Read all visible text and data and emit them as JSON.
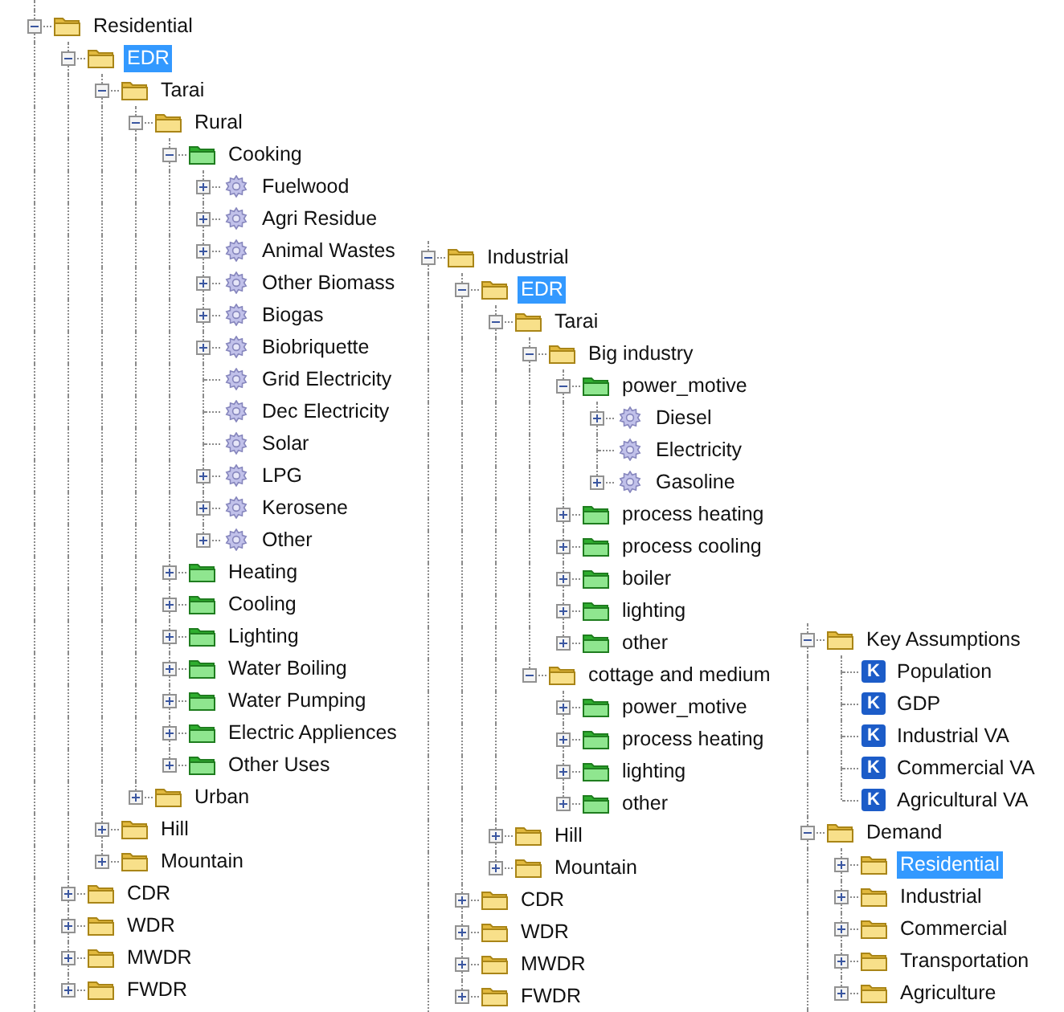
{
  "panels": [
    {
      "nodes": [
        {
          "label": "Residential",
          "kind": "folder",
          "expanded": true,
          "selected": false,
          "children": [
            {
              "label": "EDR",
              "kind": "folder",
              "expanded": true,
              "selected": true,
              "children": [
                {
                  "label": "Tarai",
                  "kind": "folder",
                  "expanded": true,
                  "selected": false,
                  "children": [
                    {
                      "label": "Rural",
                      "kind": "folder",
                      "expanded": true,
                      "selected": false,
                      "children": [
                        {
                          "label": "Cooking",
                          "kind": "enduse",
                          "expanded": true,
                          "selected": false,
                          "children": [
                            {
                              "label": "Fuelwood",
                              "kind": "fuel",
                              "expanded": false,
                              "selected": false
                            },
                            {
                              "label": "Agri Residue",
                              "kind": "fuel",
                              "expanded": false,
                              "selected": false
                            },
                            {
                              "label": "Animal Wastes",
                              "kind": "fuel",
                              "expanded": false,
                              "selected": false
                            },
                            {
                              "label": "Other Biomass",
                              "kind": "fuel",
                              "expanded": false,
                              "selected": false
                            },
                            {
                              "label": "Biogas",
                              "kind": "fuel",
                              "expanded": false,
                              "selected": false
                            },
                            {
                              "label": "Biobriquette",
                              "kind": "fuel",
                              "expanded": false,
                              "selected": false
                            },
                            {
                              "label": "Grid Electricity",
                              "kind": "fuel",
                              "selected": false
                            },
                            {
                              "label": "Dec Electricity",
                              "kind": "fuel",
                              "selected": false
                            },
                            {
                              "label": "Solar",
                              "kind": "fuel",
                              "selected": false
                            },
                            {
                              "label": "LPG",
                              "kind": "fuel",
                              "expanded": false,
                              "selected": false
                            },
                            {
                              "label": "Kerosene",
                              "kind": "fuel",
                              "expanded": false,
                              "selected": false
                            },
                            {
                              "label": "Other",
                              "kind": "fuel",
                              "expanded": false,
                              "selected": false
                            }
                          ]
                        },
                        {
                          "label": "Heating",
                          "kind": "enduse",
                          "expanded": false,
                          "selected": false
                        },
                        {
                          "label": "Cooling",
                          "kind": "enduse",
                          "expanded": false,
                          "selected": false
                        },
                        {
                          "label": "Lighting",
                          "kind": "enduse",
                          "expanded": false,
                          "selected": false
                        },
                        {
                          "label": "Water Boiling",
                          "kind": "enduse",
                          "expanded": false,
                          "selected": false
                        },
                        {
                          "label": "Water Pumping",
                          "kind": "enduse",
                          "expanded": false,
                          "selected": false
                        },
                        {
                          "label": "Electric Appliences",
                          "kind": "enduse",
                          "expanded": false,
                          "selected": false
                        },
                        {
                          "label": "Other Uses",
                          "kind": "enduse",
                          "expanded": false,
                          "selected": false
                        }
                      ]
                    },
                    {
                      "label": "Urban",
                      "kind": "folder",
                      "expanded": false,
                      "selected": false
                    }
                  ]
                },
                {
                  "label": "Hill",
                  "kind": "folder",
                  "expanded": false,
                  "selected": false
                },
                {
                  "label": "Mountain",
                  "kind": "folder",
                  "expanded": false,
                  "selected": false
                }
              ]
            },
            {
              "label": "CDR",
              "kind": "folder",
              "expanded": false,
              "selected": false
            },
            {
              "label": "WDR",
              "kind": "folder",
              "expanded": false,
              "selected": false
            },
            {
              "label": "MWDR",
              "kind": "folder",
              "expanded": false,
              "selected": false
            },
            {
              "label": "FWDR",
              "kind": "folder",
              "expanded": false,
              "selected": false
            }
          ]
        }
      ]
    },
    {
      "nodes": [
        {
          "label": "Industrial",
          "kind": "folder",
          "expanded": true,
          "selected": false,
          "children": [
            {
              "label": "EDR",
              "kind": "folder",
              "expanded": true,
              "selected": true,
              "children": [
                {
                  "label": "Tarai",
                  "kind": "folder",
                  "expanded": true,
                  "selected": false,
                  "children": [
                    {
                      "label": "Big industry",
                      "kind": "folder",
                      "expanded": true,
                      "selected": false,
                      "children": [
                        {
                          "label": "power_motive",
                          "kind": "enduse",
                          "expanded": true,
                          "selected": false,
                          "children": [
                            {
                              "label": "Diesel",
                              "kind": "fuel",
                              "expanded": false,
                              "selected": false
                            },
                            {
                              "label": "Electricity",
                              "kind": "fuel",
                              "selected": false
                            },
                            {
                              "label": "Gasoline",
                              "kind": "fuel",
                              "expanded": false,
                              "selected": false
                            }
                          ]
                        },
                        {
                          "label": "process heating",
                          "kind": "enduse",
                          "expanded": false,
                          "selected": false
                        },
                        {
                          "label": "process cooling",
                          "kind": "enduse",
                          "expanded": false,
                          "selected": false
                        },
                        {
                          "label": "boiler",
                          "kind": "enduse",
                          "expanded": false,
                          "selected": false
                        },
                        {
                          "label": "lighting",
                          "kind": "enduse",
                          "expanded": false,
                          "selected": false
                        },
                        {
                          "label": "other",
                          "kind": "enduse",
                          "expanded": false,
                          "selected": false
                        }
                      ]
                    },
                    {
                      "label": "cottage and medium",
                      "kind": "folder",
                      "expanded": true,
                      "selected": false,
                      "children": [
                        {
                          "label": "power_motive",
                          "kind": "enduse",
                          "expanded": false,
                          "selected": false
                        },
                        {
                          "label": "process heating",
                          "kind": "enduse",
                          "expanded": false,
                          "selected": false
                        },
                        {
                          "label": "lighting",
                          "kind": "enduse",
                          "expanded": false,
                          "selected": false
                        },
                        {
                          "label": "other",
                          "kind": "enduse",
                          "expanded": false,
                          "selected": false
                        }
                      ]
                    }
                  ]
                },
                {
                  "label": "Hill",
                  "kind": "folder",
                  "expanded": false,
                  "selected": false
                },
                {
                  "label": "Mountain",
                  "kind": "folder",
                  "expanded": false,
                  "selected": false
                }
              ]
            },
            {
              "label": "CDR",
              "kind": "folder",
              "expanded": false,
              "selected": false
            },
            {
              "label": "WDR",
              "kind": "folder",
              "expanded": false,
              "selected": false
            },
            {
              "label": "MWDR",
              "kind": "folder",
              "expanded": false,
              "selected": false
            },
            {
              "label": "FWDR",
              "kind": "folder",
              "expanded": false,
              "selected": false
            }
          ]
        }
      ]
    },
    {
      "nodes": [
        {
          "label": "Key Assumptions",
          "kind": "folder",
          "expanded": true,
          "selected": false,
          "children": [
            {
              "label": "Population",
              "kind": "assumption",
              "badge": "K",
              "selected": false
            },
            {
              "label": "GDP",
              "kind": "assumption",
              "badge": "K",
              "selected": false
            },
            {
              "label": "Industrial VA",
              "kind": "assumption",
              "badge": "K",
              "selected": false
            },
            {
              "label": "Commercial VA",
              "kind": "assumption",
              "badge": "K",
              "selected": false
            },
            {
              "label": "Agricultural VA",
              "kind": "assumption",
              "badge": "K",
              "selected": false
            }
          ]
        },
        {
          "label": "Demand",
          "kind": "folder",
          "expanded": true,
          "selected": false,
          "children": [
            {
              "label": "Residential",
              "kind": "folder",
              "expanded": false,
              "selected": true
            },
            {
              "label": "Industrial",
              "kind": "folder",
              "expanded": false,
              "selected": false
            },
            {
              "label": "Commercial",
              "kind": "folder",
              "expanded": false,
              "selected": false
            },
            {
              "label": "Transportation",
              "kind": "folder",
              "expanded": false,
              "selected": false
            },
            {
              "label": "Agriculture",
              "kind": "folder",
              "expanded": false,
              "selected": false
            }
          ]
        }
      ]
    }
  ]
}
